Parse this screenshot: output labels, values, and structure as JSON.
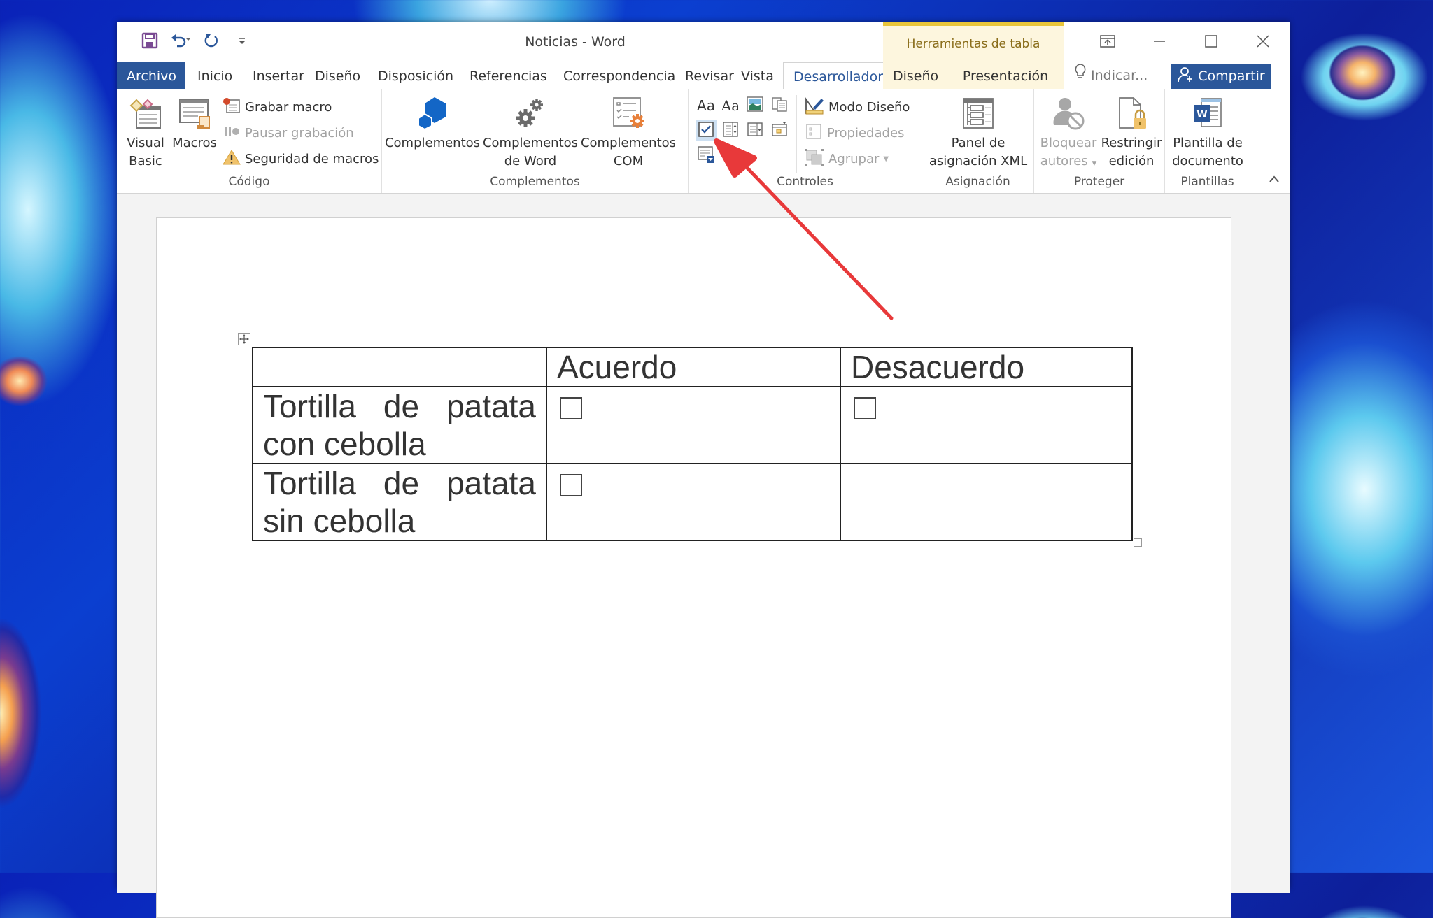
{
  "window": {
    "title": "Noticias - Word",
    "context_tab_group": "Herramientas de tabla",
    "quick_access": [
      {
        "name": "save",
        "icon": "save-icon"
      },
      {
        "name": "undo",
        "icon": "undo-icon"
      },
      {
        "name": "redo",
        "icon": "redo-icon"
      },
      {
        "name": "customize",
        "icon": "customize-qat-icon"
      }
    ],
    "controls": {
      "ribbon_display": "ribbon-display-options-icon",
      "minimize": "minimize-icon",
      "maximize": "maximize-icon",
      "close": "close-icon"
    }
  },
  "tabs": [
    {
      "label": "Archivo",
      "type": "file"
    },
    {
      "label": "Inicio"
    },
    {
      "label": "Insertar"
    },
    {
      "label": "Diseño"
    },
    {
      "label": "Disposición"
    },
    {
      "label": "Referencias"
    },
    {
      "label": "Correspondencia"
    },
    {
      "label": "Revisar"
    },
    {
      "label": "Vista"
    },
    {
      "label": "Desarrollador",
      "active": true
    },
    {
      "label": "Diseño",
      "context": true
    },
    {
      "label": "Presentación",
      "context": true
    }
  ],
  "tell_me": {
    "placeholder": "Indicar..."
  },
  "share": {
    "label": "Compartir"
  },
  "ribbon": {
    "groups": {
      "codigo": {
        "label": "Código",
        "visual_basic": {
          "line1": "Visual",
          "line2": "Basic"
        },
        "macros": {
          "label": "Macros"
        },
        "grabar_macro": {
          "label": "Grabar macro"
        },
        "pausar_grabacion": {
          "label": "Pausar grabación",
          "disabled": true
        },
        "seguridad_macros": {
          "label": "Seguridad de macros"
        }
      },
      "complementos": {
        "label": "Complementos",
        "complementos": {
          "line1": "Complementos",
          "line2": ""
        },
        "complementos_word": {
          "line1": "Complementos",
          "line2": "de Word"
        },
        "complementos_com": {
          "line1": "Complementos",
          "line2": "COM"
        }
      },
      "controles": {
        "label": "Controles",
        "rich_text": {
          "label": "Aa"
        },
        "plain_text": {
          "label": "Aa"
        },
        "modo_diseno": {
          "label": "Modo Diseño"
        },
        "propiedades": {
          "label": "Propiedades",
          "disabled": true
        },
        "agrupar": {
          "label": "Agrupar",
          "disabled": true
        },
        "checkbox_control_selected": true
      },
      "asignacion": {
        "label": "Asignación",
        "panel_xml": {
          "line1": "Panel de",
          "line2": "asignación XML"
        }
      },
      "proteger": {
        "label": "Proteger",
        "bloquear_autores": {
          "line1": "Bloquear",
          "line2": "autores",
          "disabled": true
        },
        "restringir_edicion": {
          "line1": "Restringir",
          "line2": "edición"
        }
      },
      "plantillas": {
        "label": "Plantillas",
        "plantilla_documento": {
          "line1": "Plantilla de",
          "line2": "documento"
        }
      }
    }
  },
  "document": {
    "table": {
      "headers": [
        "",
        "Acuerdo",
        "Desacuerdo"
      ],
      "rows": [
        {
          "label": "Tortilla de patata con cebolla",
          "acuerdo_checkbox": true,
          "desacuerdo_checkbox": true
        },
        {
          "label": "Tortilla de patata sin cebolla",
          "acuerdo_checkbox": true,
          "desacuerdo_checkbox": false
        }
      ]
    }
  },
  "colors": {
    "accent": "#2b579a",
    "context_tab_bg": "#fdf6de",
    "context_tab_border": "#e9c53a",
    "annotation_arrow": "#e8393a"
  }
}
